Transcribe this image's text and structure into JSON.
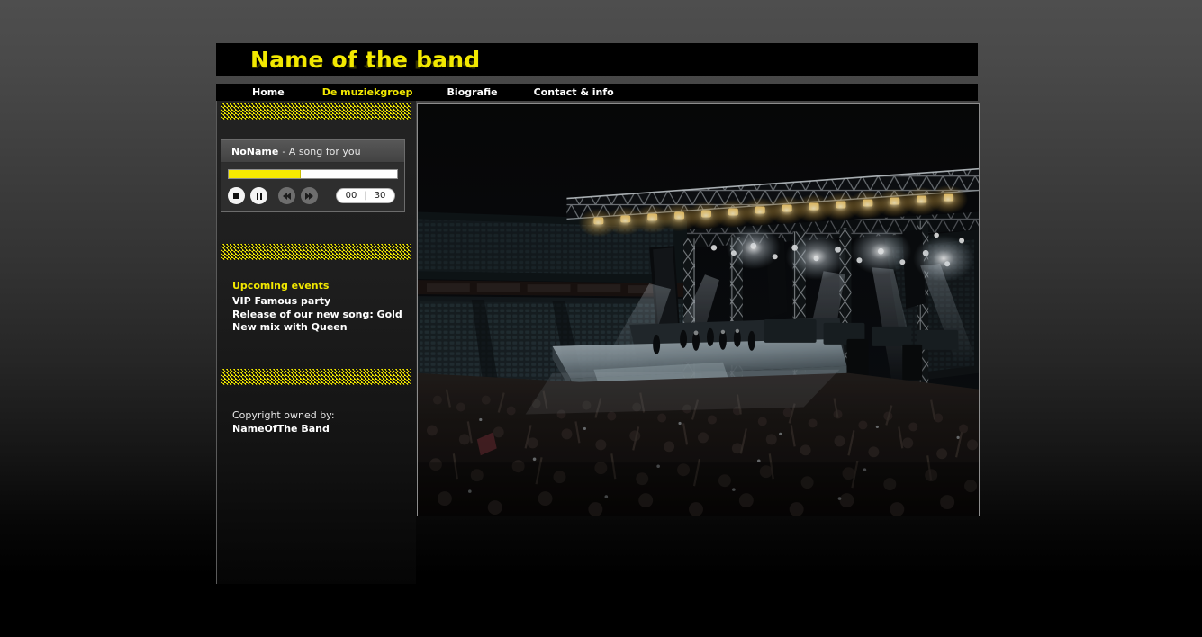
{
  "site": {
    "header": {
      "title": "Name of the band"
    },
    "nav": {
      "items": [
        {
          "label": "Home",
          "active": false
        },
        {
          "label": "De muziekgroep",
          "active": true
        },
        {
          "label": "Biografie",
          "active": false
        },
        {
          "label": "Contact & info",
          "active": false
        }
      ]
    },
    "sidebar": {
      "player": {
        "track_artist": "NoName",
        "track_name": "- A song for you",
        "progress_percent": 43,
        "controls": [
          {
            "name": "stop-button",
            "glyph": "stop-icon"
          },
          {
            "name": "pause-button",
            "glyph": "pause-icon"
          },
          {
            "name": "rewind-button",
            "glyph": "rewind-icon"
          },
          {
            "name": "fast-forward-button",
            "glyph": "fast-forward-icon"
          }
        ],
        "time_elapsed": "00",
        "time_separator": "|",
        "time_total": "30"
      },
      "events": {
        "title": "Upcoming events",
        "items": [
          "VIP Famous party",
          "Release of our new song: Gold",
          "New mix with Queen"
        ]
      },
      "copyright": {
        "line": "Copyright owned by:",
        "band": "NameOfThe Band"
      }
    },
    "main": {
      "photo": {
        "name": "concert-stage-photo",
        "alt": "Live concert in an arena: lit stage with truss lighting rig and a large crowd with raised hands"
      }
    },
    "colors": {
      "accent_yellow": "#f2e800",
      "header_black": "#000000",
      "panel_dark": "#1d1d1d",
      "player_gray": "#3a3a3a",
      "page_top_gray": "#4e4e4e"
    }
  }
}
